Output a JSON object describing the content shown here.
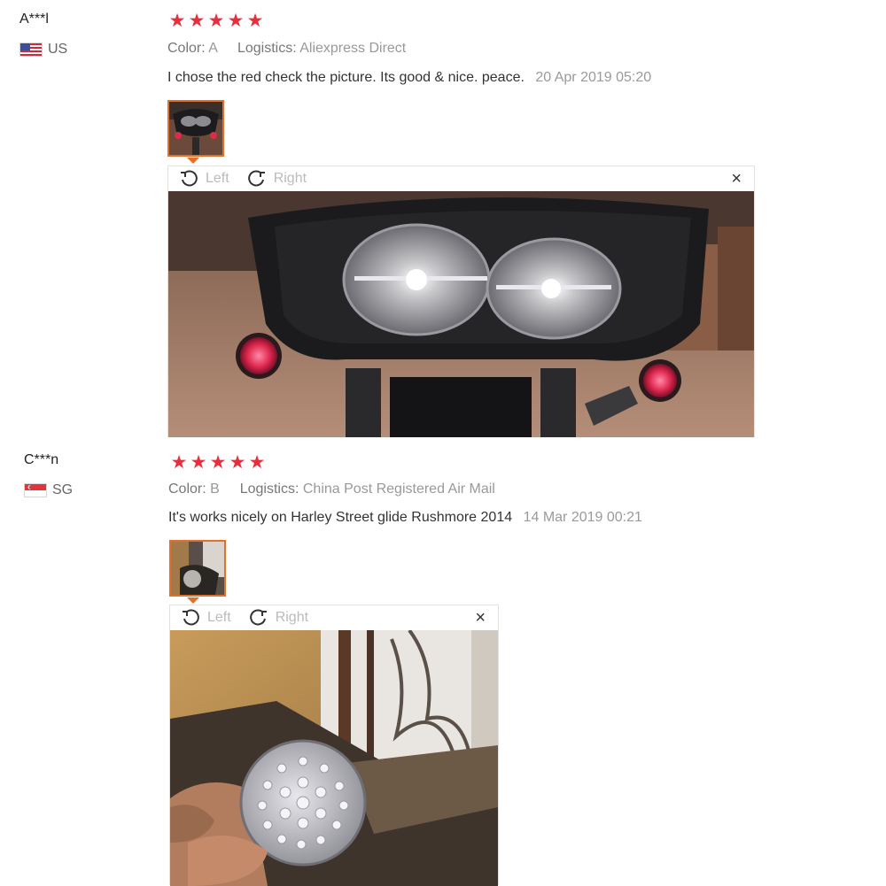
{
  "reviews": [
    {
      "user": "A***l",
      "country": "US",
      "stars": [
        "★",
        "★",
        "★",
        "★",
        "★"
      ],
      "color_label": "Color:",
      "color_value": "A",
      "logistics_label": "Logistics:",
      "logistics_value": "Aliexpress Direct",
      "text": "I chose the red check the picture. Its good & nice. peace.",
      "date": "20 Apr 2019 05:20",
      "viewer": {
        "rotate_left": "Left",
        "rotate_right": "Right",
        "close": "×"
      }
    },
    {
      "user": "C***n",
      "country": "SG",
      "stars": [
        "★",
        "★",
        "★",
        "★",
        "★"
      ],
      "color_label": "Color:",
      "color_value": "B",
      "logistics_label": "Logistics:",
      "logistics_value": "China Post Registered Air Mail",
      "text": "It's works nicely on Harley Street glide Rushmore 2014",
      "date": "14 Mar 2019 00:21",
      "viewer": {
        "rotate_left": "Left",
        "rotate_right": "Right",
        "close": "×"
      }
    }
  ],
  "colors": {
    "star": "#e62e3d",
    "thumb_border": "#e0702a",
    "muted_text": "#999999"
  }
}
